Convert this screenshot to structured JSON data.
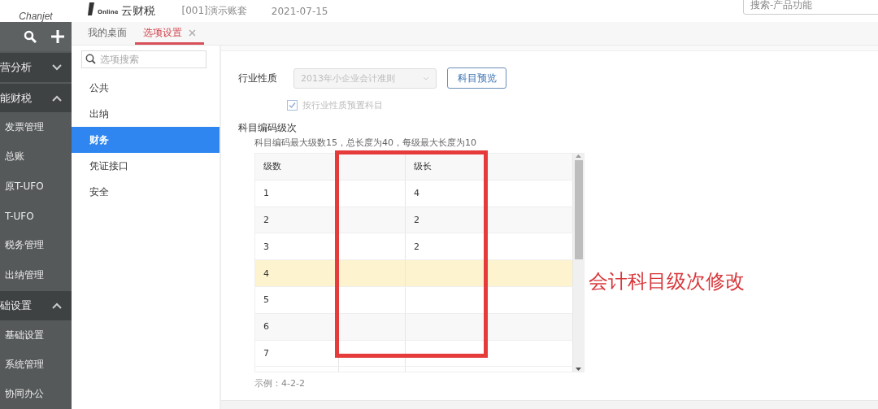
{
  "header": {
    "logo_sub": "Chanjet",
    "product_badge": "Online",
    "product_name": "云财税",
    "account": "[001]演示账套",
    "date": "2021-07-15",
    "search": {
      "placeholder": "搜索-产品功能"
    }
  },
  "tabs": [
    {
      "label": "我的桌面",
      "selected": false,
      "closable": false
    },
    {
      "label": "选项设置",
      "selected": true,
      "closable": true
    }
  ],
  "sidebar": {
    "items": [
      {
        "kind": "group",
        "label": "营分析",
        "expanded": false
      },
      {
        "kind": "group",
        "label": "能财税",
        "expanded": true
      },
      {
        "kind": "item",
        "label": "发票管理"
      },
      {
        "kind": "item",
        "label": "总账"
      },
      {
        "kind": "item",
        "label": "原T-UFO"
      },
      {
        "kind": "item",
        "label": "T-UFO"
      },
      {
        "kind": "item",
        "label": "税务管理"
      },
      {
        "kind": "item",
        "label": "出纳管理"
      },
      {
        "kind": "group",
        "label": "础设置",
        "expanded": true
      },
      {
        "kind": "item",
        "label": "基础设置"
      },
      {
        "kind": "item",
        "label": "系统管理"
      },
      {
        "kind": "item",
        "label": "协同办公"
      }
    ]
  },
  "options": {
    "search": {
      "placeholder": "选项搜索"
    },
    "items": [
      {
        "label": "公共",
        "selected": false
      },
      {
        "label": "出纳",
        "selected": false
      },
      {
        "label": "财务",
        "selected": true
      },
      {
        "label": "凭证接口",
        "selected": false
      },
      {
        "label": "安全",
        "selected": false
      }
    ]
  },
  "form": {
    "industry_label": "行业性质",
    "industry_value": "2013年小企业会计准则",
    "industry_disabled": true,
    "preview_button": "科目预览",
    "preset_checkbox": {
      "label": "按行业性质预置科目",
      "checked": true,
      "disabled": true
    },
    "section_title": "科目编码级次",
    "section_note": "科目编码最大级数15，总长度为40，每级最大长度为10",
    "table": {
      "columns": [
        "级数",
        "",
        "级长"
      ],
      "rows": [
        {
          "cells": [
            "1",
            "",
            "4"
          ],
          "selected": false
        },
        {
          "cells": [
            "2",
            "",
            "2"
          ],
          "selected": false
        },
        {
          "cells": [
            "3",
            "",
            "2"
          ],
          "selected": false
        },
        {
          "cells": [
            "4",
            "",
            ""
          ],
          "selected": true
        },
        {
          "cells": [
            "5",
            "",
            ""
          ],
          "selected": false
        },
        {
          "cells": [
            "6",
            "",
            ""
          ],
          "selected": false
        },
        {
          "cells": [
            "7",
            "",
            ""
          ],
          "selected": false
        }
      ]
    },
    "example": "示例：4-2-2"
  },
  "annotation": {
    "text": "会计科目级次修改"
  }
}
